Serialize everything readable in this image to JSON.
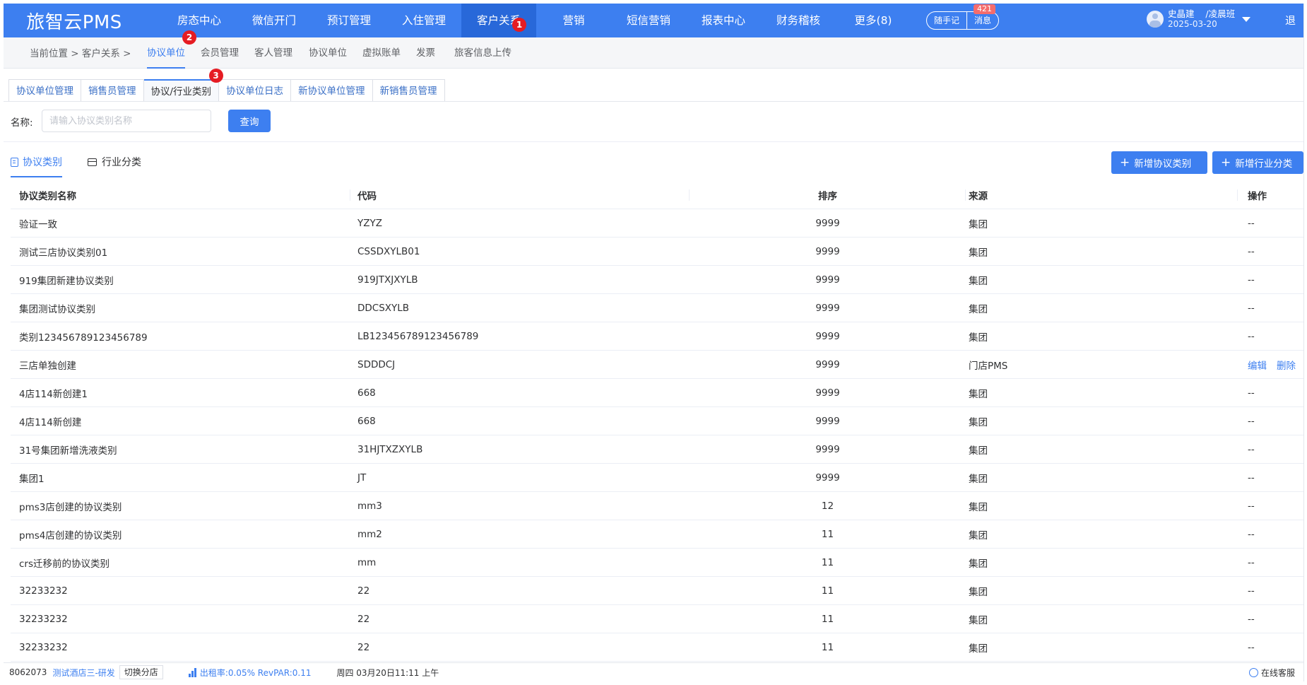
{
  "app": {
    "logo": "旅智云PMS"
  },
  "nav": {
    "items": [
      {
        "label": "房态中心"
      },
      {
        "label": "微信开门"
      },
      {
        "label": "预订管理"
      },
      {
        "label": "入住管理"
      },
      {
        "label": "客户关系"
      },
      {
        "label": "营销"
      },
      {
        "label": "短信营销"
      },
      {
        "label": "报表中心"
      },
      {
        "label": "财务稽核"
      },
      {
        "label": "更多(8)"
      }
    ],
    "active": "客户关系",
    "notepad": "随手记",
    "message": "消息",
    "message_count": "421"
  },
  "user": {
    "name": "史晶建",
    "shift": "/凌晨班",
    "date": "2025-03-20",
    "logout": "退出"
  },
  "markers": {
    "m1": "1",
    "m2": "2",
    "m3": "3"
  },
  "breadcrumb": "当前位置 > 客户关系 >",
  "subnav": {
    "items": [
      {
        "label": "协议单位"
      },
      {
        "label": "会员管理"
      },
      {
        "label": "客人管理"
      },
      {
        "label": "协议单位"
      },
      {
        "label": "虚拟账单"
      },
      {
        "label": "发票"
      },
      {
        "label": "旅客信息上传"
      }
    ]
  },
  "tabs": {
    "items": [
      {
        "label": "协议单位管理"
      },
      {
        "label": "销售员管理"
      },
      {
        "label": "协议/行业类别"
      },
      {
        "label": "协议单位日志"
      },
      {
        "label": "新协议单位管理"
      },
      {
        "label": "新销售员管理"
      }
    ]
  },
  "search": {
    "label": "名称:",
    "placeholder": "请输入协议类别名称",
    "value": "",
    "button": "查询"
  },
  "category_tabs": {
    "agreement": "协议类别",
    "industry": "行业分类"
  },
  "actions": {
    "add_agreement": "新增协议类别",
    "add_industry": "新增行业分类"
  },
  "table": {
    "headers": {
      "name": "协议类别名称",
      "code": "代码",
      "sort": "排序",
      "source": "来源",
      "ops": "操作"
    },
    "rows": [
      {
        "name": "验证一致",
        "code": "YZYZ",
        "sort": "9999",
        "source": "集团",
        "ops": "--"
      },
      {
        "name": "测试三店协议类别01",
        "code": "CSSDXYLB01",
        "sort": "9999",
        "source": "集团",
        "ops": "--"
      },
      {
        "name": "919集团新建协议类别",
        "code": "919JTXJXYLB",
        "sort": "9999",
        "source": "集团",
        "ops": "--"
      },
      {
        "name": "集团测试协议类别",
        "code": "DDCSXYLB",
        "sort": "9999",
        "source": "集团",
        "ops": "--"
      },
      {
        "name": "类别123456789123456789",
        "code": "LB123456789123456789",
        "sort": "9999",
        "source": "集团",
        "ops": "--"
      },
      {
        "name": "三店单独创建",
        "code": "SDDDCJ",
        "sort": "9999",
        "source": "门店PMS",
        "ops": "",
        "edit": "编辑",
        "delete": "删除"
      },
      {
        "name": "4店114新创建1",
        "code": "668",
        "sort": "9999",
        "source": "集团",
        "ops": "--"
      },
      {
        "name": "4店114新创建",
        "code": "668",
        "sort": "9999",
        "source": "集团",
        "ops": "--"
      },
      {
        "name": "31号集团新增洗液类别",
        "code": "31HJTXZXYLB",
        "sort": "9999",
        "source": "集团",
        "ops": "--"
      },
      {
        "name": "集团1",
        "code": "JT",
        "sort": "9999",
        "source": "集团",
        "ops": "--"
      },
      {
        "name": "pms3店创建的协议类别",
        "code": "mm3",
        "sort": "12",
        "source": "集团",
        "ops": "--"
      },
      {
        "name": "pms4店创建的协议类别",
        "code": "mm2",
        "sort": "11",
        "source": "集团",
        "ops": "--"
      },
      {
        "name": "crs迁移前的协议类别",
        "code": "mm",
        "sort": "11",
        "source": "集团",
        "ops": "--"
      },
      {
        "name": "32233232",
        "code": "22",
        "sort": "11",
        "source": "集团",
        "ops": "--"
      },
      {
        "name": "32233232",
        "code": "22",
        "sort": "11",
        "source": "集团",
        "ops": "--"
      },
      {
        "name": "32233232",
        "code": "22",
        "sort": "11",
        "source": "集团",
        "ops": "--"
      }
    ]
  },
  "statusbar": {
    "hotel_id": "8062073",
    "hotel_name": "测试酒店三-研发",
    "switch": "切换分店",
    "occupancy": "出租率:0.05% RevPAR:0.11",
    "datetime": "周四 03月20日11:11 上午",
    "service": "在线客服"
  },
  "colors": {
    "primary": "#3d7ff0",
    "nav_active": "#2868d9",
    "badge": "#e51c23",
    "message_badge": "#f56c6c"
  }
}
